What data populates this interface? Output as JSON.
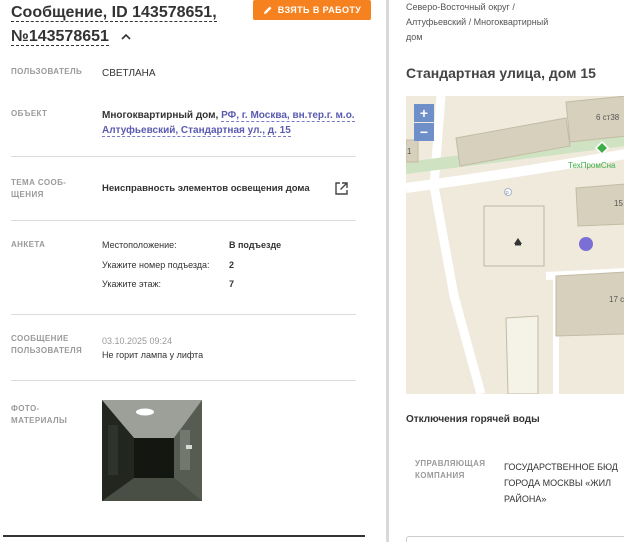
{
  "message": {
    "title_line1": "Сообщение, ID 143578651,",
    "title_line2": "№143578651",
    "take_button": "ВЗЯТЬ В РАБОТУ"
  },
  "fields": {
    "user_label": "ПОЛЬЗОВАТЕЛЬ",
    "user_value": "СВЕТЛАНА",
    "object_label": "ОБЪЕКТ",
    "object_prefix": "Многоквартирный дом,",
    "object_addr_1": "РФ, г. Москва, вн.тер.г. м.о.",
    "object_addr_2": "Алтуфьевский, Стандартная ул., д. 15",
    "topic_label_1": "ТЕМА СООБ-",
    "topic_label_2": "ЩЕНИЯ",
    "topic_value": "Неисправность элементов освещения дома",
    "survey_label": "АНКЕТА",
    "survey": [
      {
        "key": "Местоположение:",
        "value": "В подъезде"
      },
      {
        "key": "Укажите номер подъезда:",
        "value": "2"
      },
      {
        "key": "Укажите этаж:",
        "value": "7"
      }
    ],
    "user_msg_label_1": "СООБЩЕНИЕ",
    "user_msg_label_2": "ПОЛЬЗОВАТЕЛЯ",
    "user_msg_date": "03.10.2025 09:24",
    "user_msg_text": "Не горит лампа у лифта",
    "photo_label_1": "ФОТО-",
    "photo_label_2": "МАТЕРИАЛЫ"
  },
  "right": {
    "breadcrumb_1": "Северо-Восточный округ /",
    "breadcrumb_2": "Алтуфьевский / Многоквартирный",
    "breadcrumb_3": "дом",
    "address_title": "Стандартная улица, дом 15",
    "map": {
      "zoom_in": "+",
      "zoom_out": "−",
      "label_6st": "6 ст38",
      "label_shop": "ТехПромСна",
      "label_15": "15",
      "label_17": "17 с",
      "label_1": "1",
      "label_r": "Р"
    },
    "hot_water_title": "Отключения горячей воды",
    "uk_label_1": "УПРАВЛЯЮЩАЯ",
    "uk_label_2": "КОМПАНИЯ",
    "uk_value_1": "ГОСУДАРСТВЕННОЕ БЮД",
    "uk_value_2": "ГОРОДА МОСКВЫ «ЖИЛ",
    "uk_value_3": "РАЙОНА»"
  },
  "colors": {
    "accent": "#f5821f",
    "link": "#5a5ab0",
    "marker": "#7b6fd6",
    "shop_marker": "#3fae49"
  },
  "icons": [
    "chevron-up-icon",
    "pencil-icon",
    "external-link-icon",
    "zoom-in-icon",
    "zoom-out-icon",
    "map-marker-icon"
  ]
}
